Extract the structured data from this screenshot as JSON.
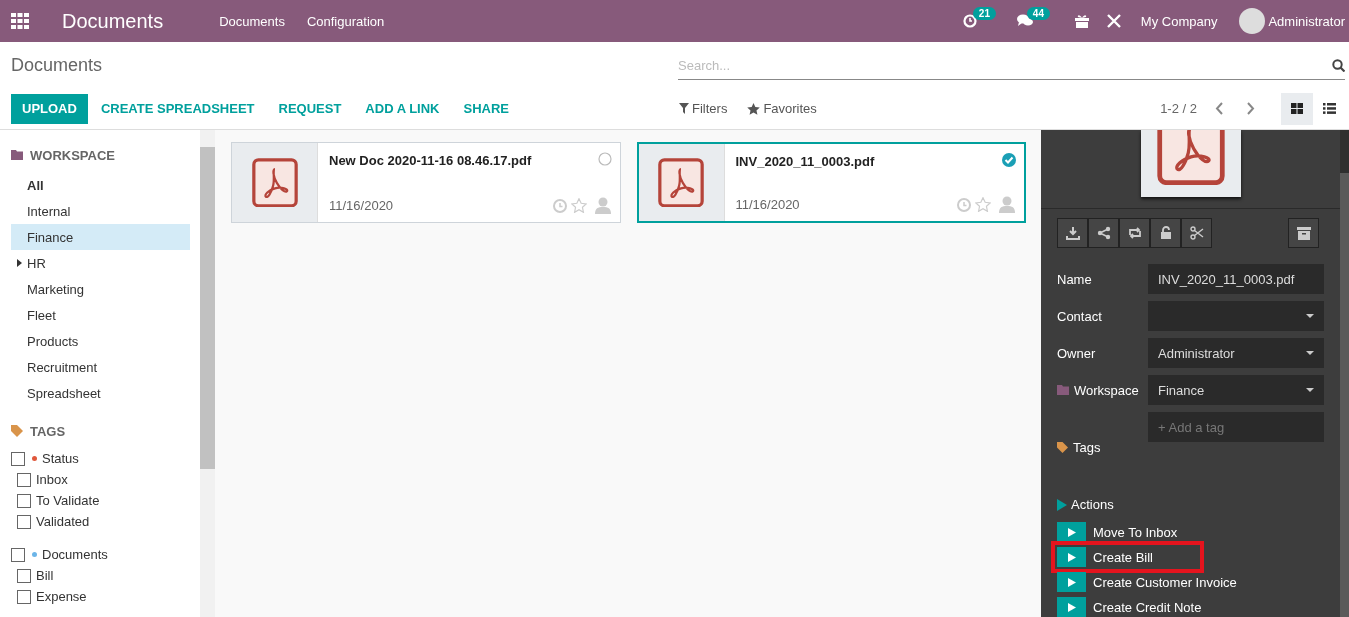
{
  "navbar": {
    "app_title": "Documents",
    "menus": [
      "Documents",
      "Configuration"
    ],
    "activity_count": "21",
    "message_count": "44",
    "company": "My Company",
    "user": "Administrator"
  },
  "control_panel": {
    "breadcrumb": "Documents",
    "search": {
      "placeholder": "Search..."
    },
    "buttons": [
      {
        "label": "UPLOAD",
        "kind": "primary"
      },
      {
        "label": "CREATE SPREADSHEET",
        "kind": "link"
      },
      {
        "label": "REQUEST",
        "kind": "link"
      },
      {
        "label": "ADD A LINK",
        "kind": "link"
      },
      {
        "label": "SHARE",
        "kind": "link"
      }
    ],
    "filters": "Filters",
    "favorites": "Favorites",
    "pager": "1-2 / 2",
    "views": [
      {
        "kind": "kanban",
        "selected": true
      },
      {
        "kind": "list",
        "selected": false
      }
    ]
  },
  "sidebar": {
    "workspace_heading": "WORKSPACE",
    "workspaces": [
      {
        "label": "All",
        "kind": "all",
        "selected": false,
        "expandable": false
      },
      {
        "label": "Internal",
        "kind": "folder",
        "selected": false,
        "expandable": false
      },
      {
        "label": "Finance",
        "kind": "folder",
        "selected": true,
        "expandable": false
      },
      {
        "label": "HR",
        "kind": "folder",
        "selected": false,
        "expandable": true
      },
      {
        "label": "Marketing",
        "kind": "folder",
        "selected": false,
        "expandable": false
      },
      {
        "label": "Fleet",
        "kind": "folder",
        "selected": false,
        "expandable": false
      },
      {
        "label": "Products",
        "kind": "folder",
        "selected": false,
        "expandable": false
      },
      {
        "label": "Recruitment",
        "kind": "folder",
        "selected": false,
        "expandable": false
      },
      {
        "label": "Spreadsheet",
        "kind": "folder",
        "selected": false,
        "expandable": false
      }
    ],
    "tags_heading": "TAGS",
    "tag_groups": [
      {
        "label": "Status",
        "color": "#e0583c",
        "checked": false,
        "children": [
          {
            "label": "Inbox",
            "checked": false
          },
          {
            "label": "To Validate",
            "checked": false
          },
          {
            "label": "Validated",
            "checked": false
          }
        ]
      },
      {
        "label": "Documents",
        "color": "#6cb5e8",
        "checked": false,
        "children": [
          {
            "label": "Bill",
            "checked": false
          },
          {
            "label": "Expense",
            "checked": false
          }
        ]
      }
    ]
  },
  "documents": [
    {
      "name": "New Doc 2020-11-16 08.46.17.pdf",
      "date": "11/16/2020",
      "selected": false
    },
    {
      "name": "INV_2020_11_0003.pdf",
      "date": "11/16/2020",
      "selected": true
    }
  ],
  "inspector": {
    "fields": [
      {
        "label": "Name",
        "kind": "text",
        "value": "INV_2020_11_0003.pdf"
      },
      {
        "label": "Contact",
        "kind": "select"
      },
      {
        "label": "Owner",
        "kind": "select",
        "value": "Administrator"
      },
      {
        "label": "Workspace",
        "kind": "folder-select",
        "value": "Finance"
      },
      {
        "label": "Tags",
        "kind": "tags",
        "placeholder": "+ Add a tag"
      }
    ],
    "actions_heading": "Actions",
    "actions": [
      {
        "label": "Move To Inbox",
        "highlighted": false
      },
      {
        "label": "Create Bill",
        "highlighted": true
      },
      {
        "label": "Create Customer Invoice",
        "highlighted": false
      },
      {
        "label": "Create Credit Note",
        "highlighted": false
      }
    ]
  }
}
